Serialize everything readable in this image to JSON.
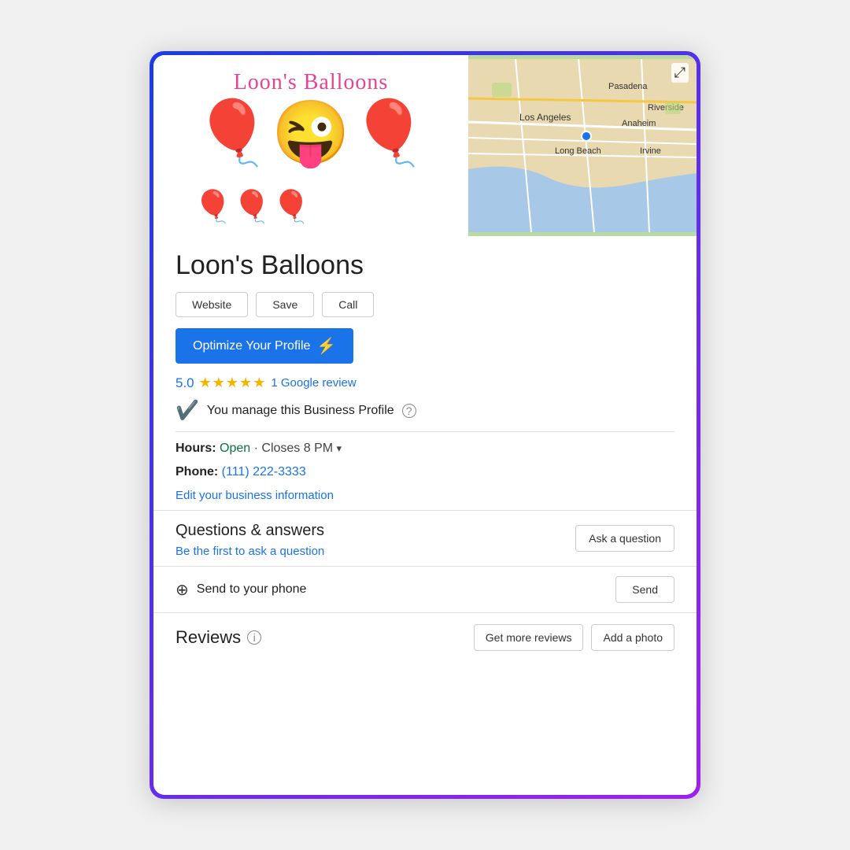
{
  "frame": {
    "border_gradient_start": "#1a3ce8",
    "border_gradient_end": "#a020f0"
  },
  "logo": {
    "title": "Loon's Balloons",
    "emoji": "🎈🎟️😜🎈",
    "balloon_display": "🎈"
  },
  "map": {
    "expand_icon": "⤢",
    "labels": [
      "Pasadena",
      "Los Angeles",
      "Anaheim",
      "Riverside",
      "Long Beach",
      "Irvine"
    ]
  },
  "business": {
    "name": "Loon's Balloons",
    "buttons": {
      "website": "Website",
      "save": "Save",
      "call": "Call"
    },
    "optimize_label": "Optimize Your Profile",
    "lightning": "⚡",
    "rating": {
      "number": "5.0",
      "stars": "★★★★★",
      "review_text": "1 Google review"
    },
    "manage": {
      "text": "You manage this Business Profile",
      "help": "?"
    }
  },
  "hours": {
    "label": "Hours:",
    "status": "Open",
    "separator": " · ",
    "closes": "Closes 8 PM"
  },
  "phone": {
    "label": "Phone:",
    "number": "(111) 222-3333"
  },
  "edit_link": "Edit your business information",
  "qa": {
    "title": "Questions & answers",
    "link_text": "Be the first to ask a question",
    "ask_btn": "Ask a question"
  },
  "send": {
    "icon": "⊕",
    "label": "Send to your phone",
    "btn": "Send"
  },
  "reviews": {
    "title": "Reviews",
    "info": "ℹ",
    "get_reviews_btn": "Get more reviews",
    "add_photo_btn": "Add a photo"
  }
}
